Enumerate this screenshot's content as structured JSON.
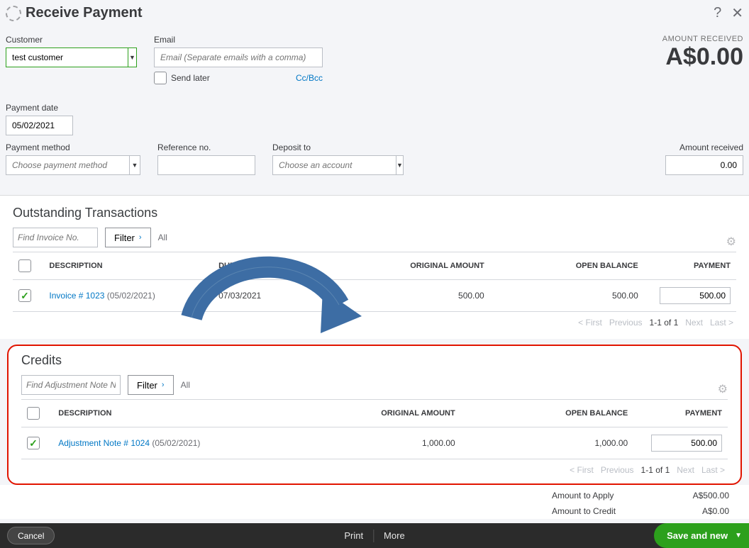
{
  "header": {
    "title": "Receive Payment"
  },
  "topform": {
    "customer_label": "Customer",
    "customer_value": "test customer",
    "email_label": "Email",
    "email_placeholder": "Email (Separate emails with a comma)",
    "send_later": "Send later",
    "ccbcc": "Cc/Bcc",
    "amount_received_title": "AMOUNT RECEIVED",
    "amount_received_value": "A$0.00",
    "payment_date_label": "Payment date",
    "payment_date_value": "05/02/2021",
    "payment_method_label": "Payment method",
    "payment_method_placeholder": "Choose payment method",
    "reference_label": "Reference no.",
    "deposit_label": "Deposit to",
    "deposit_placeholder": "Choose an account",
    "amount_rcv_label": "Amount received",
    "amount_rcv_value": "0.00"
  },
  "outstanding": {
    "title": "Outstanding Transactions",
    "find_placeholder": "Find Invoice No.",
    "filter_label": "Filter",
    "all_label": "All",
    "cols": {
      "desc": "DESCRIPTION",
      "due": "DUE DATE",
      "orig": "ORIGINAL AMOUNT",
      "open": "OPEN BALANCE",
      "pay": "PAYMENT"
    },
    "row": {
      "link": "Invoice # 1023",
      "date": "(05/02/2021)",
      "due": "07/03/2021",
      "orig": "500.00",
      "open": "500.00",
      "pay": "500.00"
    },
    "pager": {
      "first": "< First",
      "prev": "Previous",
      "range": "1-1 of 1",
      "next": "Next",
      "last": "Last >"
    }
  },
  "credits": {
    "title": "Credits",
    "find_placeholder": "Find Adjustment Note N",
    "filter_label": "Filter",
    "all_label": "All",
    "cols": {
      "desc": "DESCRIPTION",
      "orig": "ORIGINAL AMOUNT",
      "open": "OPEN BALANCE",
      "pay": "PAYMENT"
    },
    "row": {
      "link": "Adjustment Note # 1024",
      "date": "(05/02/2021)",
      "orig": "1,000.00",
      "open": "1,000.00",
      "pay": "500.00"
    },
    "pager": {
      "first": "< First",
      "prev": "Previous",
      "range": "1-1 of 1",
      "next": "Next",
      "last": "Last >"
    }
  },
  "summary": {
    "apply_label": "Amount to Apply",
    "apply_value": "A$500.00",
    "credit_label": "Amount to Credit",
    "credit_value": "A$0.00"
  },
  "footer": {
    "cancel": "Cancel",
    "print": "Print",
    "more": "More",
    "save": "Save and new"
  }
}
